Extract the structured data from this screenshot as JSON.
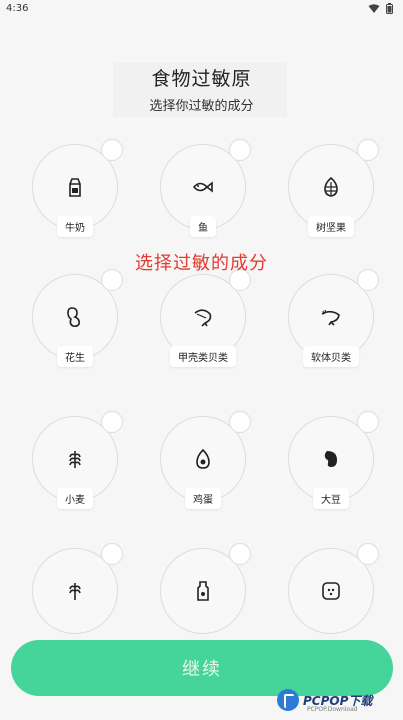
{
  "status": {
    "time": "4:36"
  },
  "header": {
    "title": "食物过敏原",
    "subtitle": "选择你过敏的成分"
  },
  "items": [
    {
      "label": "牛奶",
      "icon": "milk-carton-icon"
    },
    {
      "label": "鱼",
      "icon": "fish-icon"
    },
    {
      "label": "树坚果",
      "icon": "tree-nut-icon"
    },
    {
      "label": "花生",
      "icon": "peanut-icon"
    },
    {
      "label": "甲壳类贝类",
      "icon": "shrimp-icon"
    },
    {
      "label": "软体贝类",
      "icon": "mollusk-icon"
    },
    {
      "label": "小麦",
      "icon": "wheat-icon"
    },
    {
      "label": "鸡蛋",
      "icon": "egg-icon"
    },
    {
      "label": "大豆",
      "icon": "soybean-icon"
    },
    {
      "label": "",
      "icon": "grain-icon"
    },
    {
      "label": "",
      "icon": "bottle-icon"
    },
    {
      "label": "",
      "icon": "sesame-icon"
    }
  ],
  "overlay_text": "选择过敏的成分",
  "footer": {
    "continue_label": "继续"
  },
  "watermark": {
    "text": "PCPOP下载",
    "sub": "PCPOP.Download"
  },
  "colors": {
    "accent": "#45d49a",
    "overlay_text": "#e23b30"
  }
}
